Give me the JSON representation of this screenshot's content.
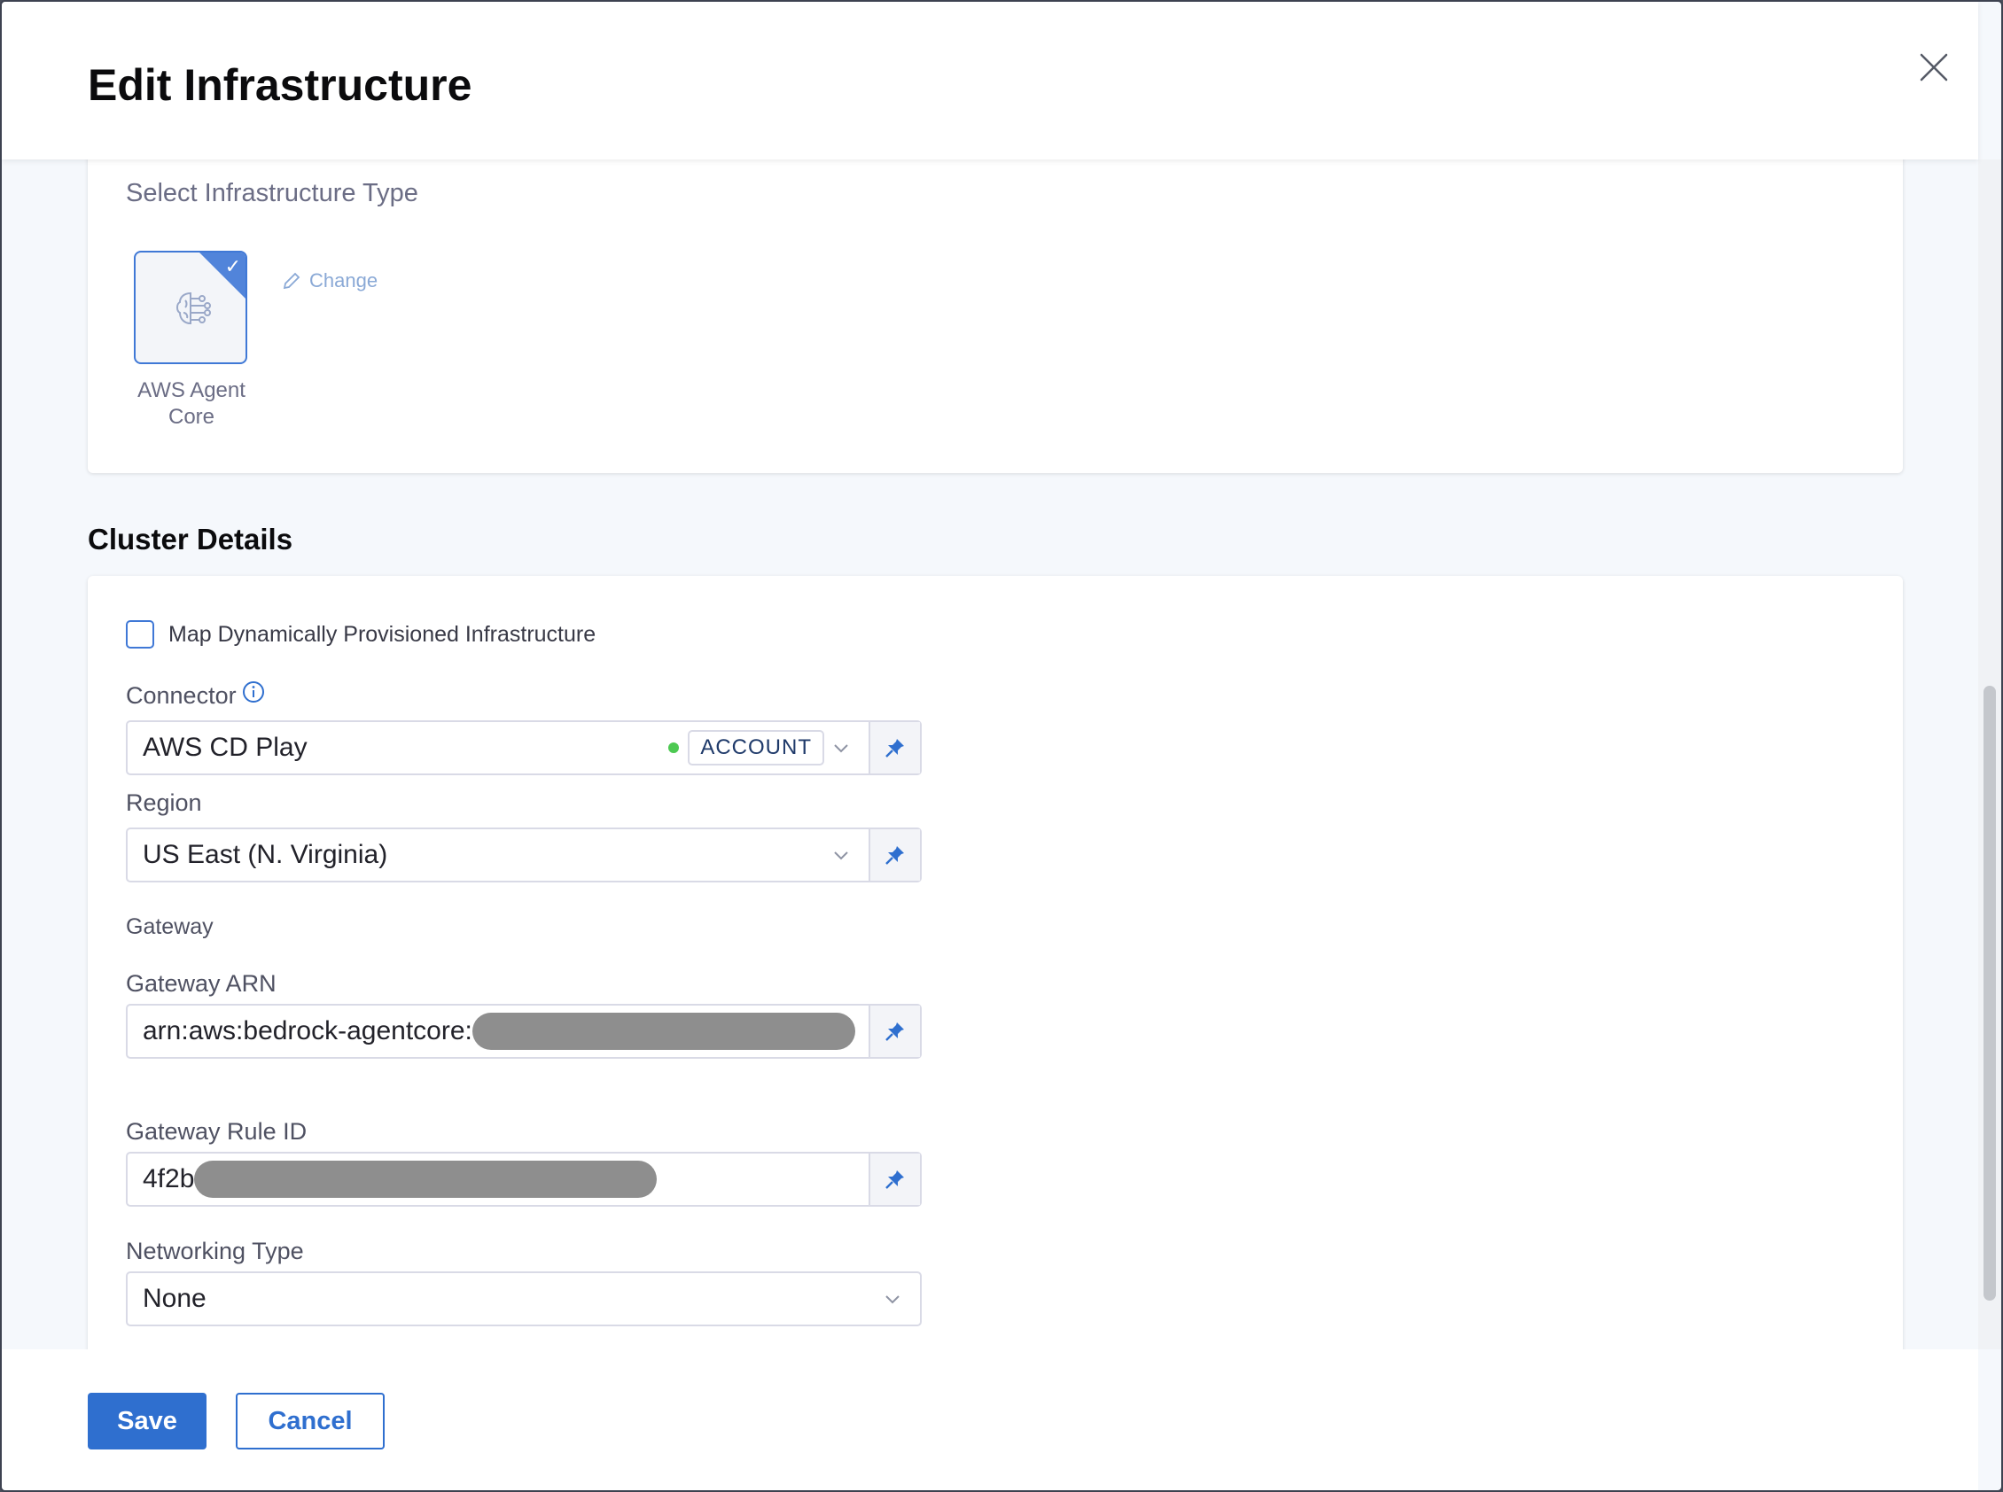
{
  "dialog": {
    "title": "Edit Infrastructure",
    "close_icon": "close-icon"
  },
  "infrastructure": {
    "section_label": "Select Infrastructure Type",
    "selected_type": {
      "label": "AWS Agent Core",
      "icon": "brain-circuit-icon",
      "selected": true
    },
    "change_label": "Change"
  },
  "cluster": {
    "title": "Cluster Details",
    "map_dynamic": {
      "label": "Map Dynamically Provisioned Infrastructure",
      "checked": false
    },
    "connector": {
      "label": "Connector",
      "value": "AWS CD Play",
      "status_color": "#4dc952",
      "scope_badge": "ACCOUNT"
    },
    "region": {
      "label": "Region",
      "value": "US East (N. Virginia)"
    },
    "gateway_heading": "Gateway",
    "gateway_arn": {
      "label": "Gateway ARN",
      "value": "arn:aws:bedrock-agentcore:"
    },
    "gateway_rule_id": {
      "label": "Gateway Rule ID",
      "value": "4f2b"
    },
    "networking_type": {
      "label": "Networking Type",
      "value": "None"
    }
  },
  "footer": {
    "save_label": "Save",
    "cancel_label": "Cancel"
  },
  "colors": {
    "accent": "#2f6fcf",
    "selected_border": "#3f78d6"
  }
}
